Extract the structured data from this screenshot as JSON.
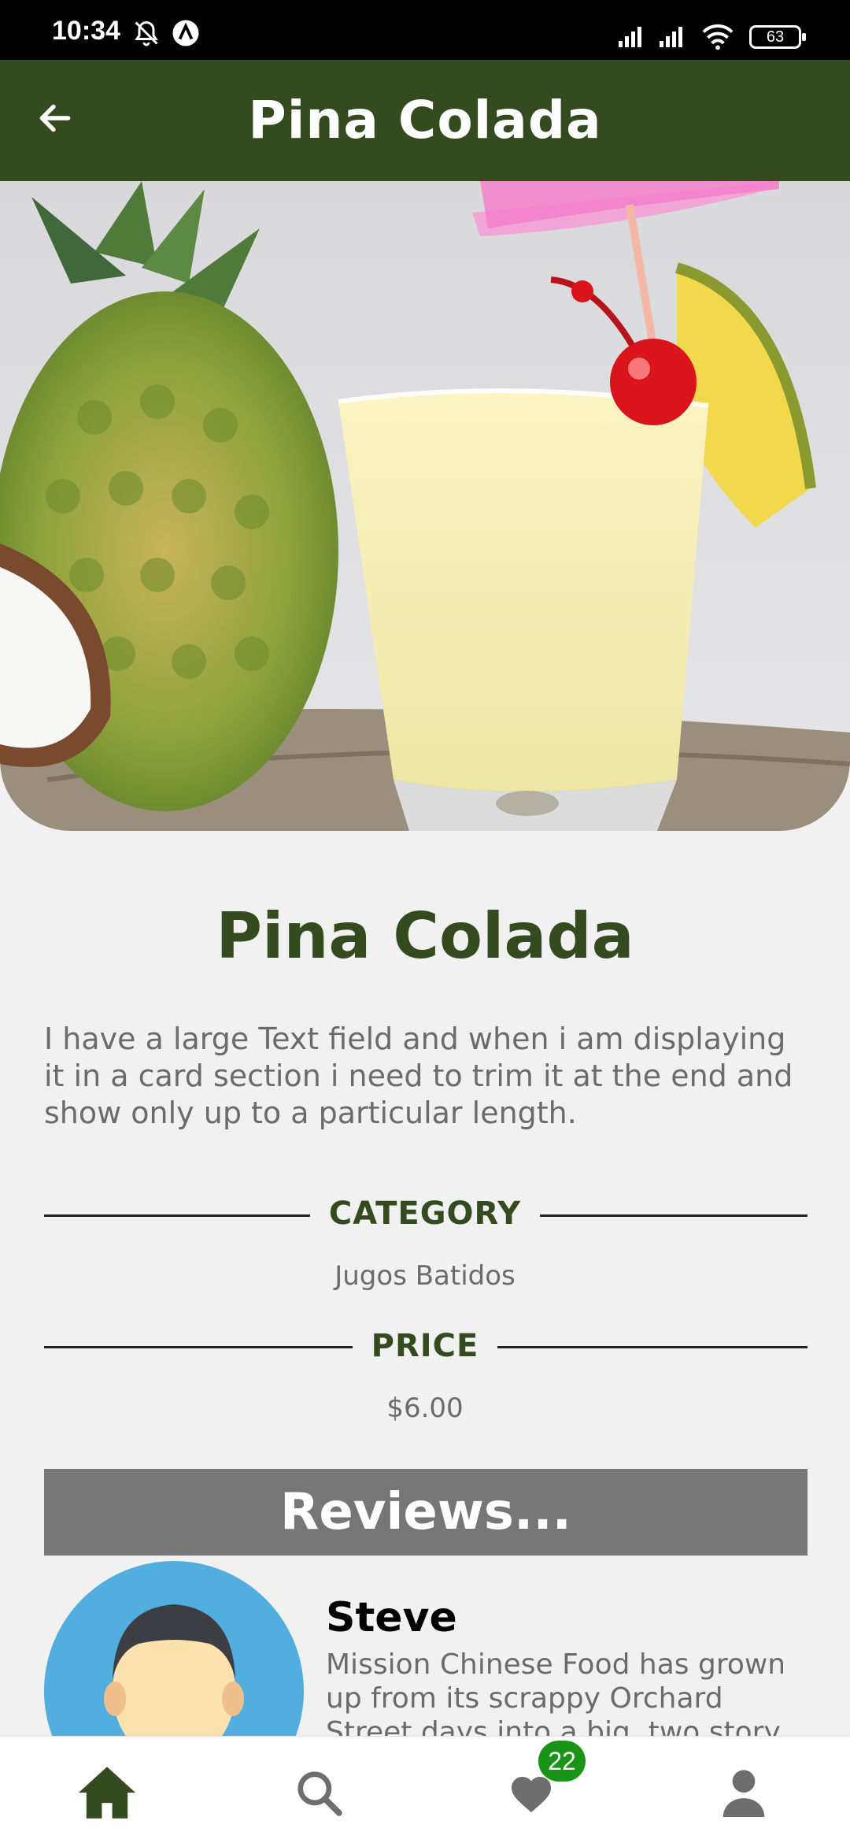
{
  "status_bar": {
    "time": "10:34",
    "battery": "63"
  },
  "app_bar": {
    "title": "Pina Colada"
  },
  "drink": {
    "name": "Pina Colada",
    "description": "I have a large Text field and when i am displaying it in a card section i need to trim it at the end and show only up to a particular length.",
    "category_label": "CATEGORY",
    "category_value": "Jugos Batidos",
    "price_label": "PRICE",
    "price_value": "$6.00"
  },
  "reviews": {
    "heading": "Reviews...",
    "items": [
      {
        "name": "Steve",
        "text": "Mission Chinese Food has grown up from its scrappy Orchard Street days into a big, two story"
      }
    ]
  },
  "bottom_nav": {
    "items": [
      {
        "icon": "home-icon",
        "active": true
      },
      {
        "icon": "search-icon",
        "active": false
      },
      {
        "icon": "heart-icon",
        "active": false
      },
      {
        "icon": "person-icon",
        "active": false
      }
    ],
    "favorites_badge": "22"
  },
  "colors": {
    "primary": "#344b20",
    "reviews_bar": "#767676",
    "badge": "#1a9417",
    "avatar_bg": "#53aee0"
  }
}
